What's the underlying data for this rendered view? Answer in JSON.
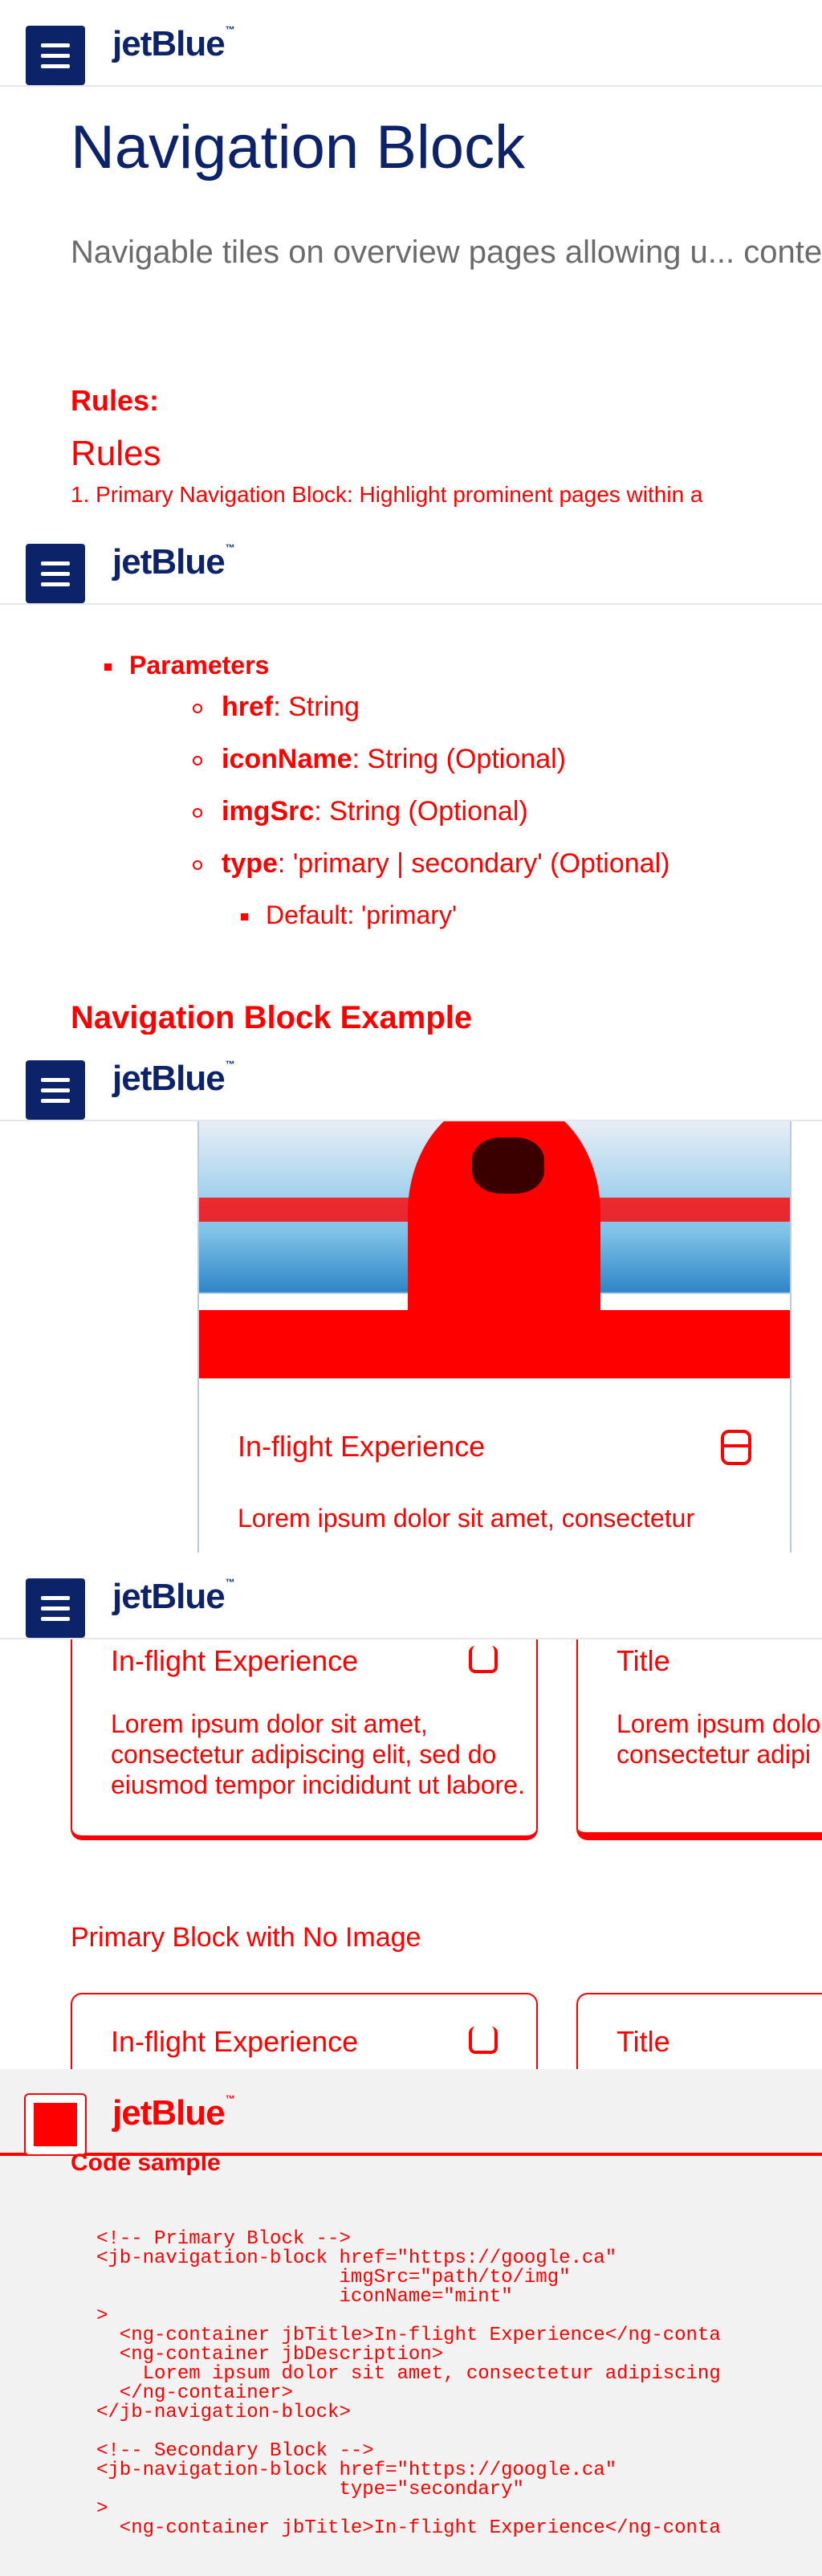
{
  "header": {
    "logo_text": "jetBlue",
    "logo_mark": "™",
    "menu_icon": "hamburger-icon"
  },
  "intro": {
    "title": "Navigation Block",
    "description": "Navigable tiles on overview pages allowing u... content.",
    "rules_label": "Rules:",
    "rules_heading": "Rules",
    "rule_1": "1. Primary Navigation Block: Highlight prominent pages within a"
  },
  "parameters": {
    "heading": "Parameters",
    "items": [
      {
        "name": "href",
        "type": ": String"
      },
      {
        "name": "iconName",
        "type": ": String (Optional)"
      },
      {
        "name": "imgSrc",
        "type": ": String (Optional)"
      },
      {
        "name": "type",
        "type": ": 'primary | secondary' (Optional)"
      }
    ],
    "default_note": "Default: 'primary'",
    "example_heading": "Navigation Block Example"
  },
  "example": {
    "tile_title": "In-flight Experience",
    "tile_desc": "Lorem ipsum dolor sit amet, consectetur",
    "icon": "database-icon"
  },
  "tiles": {
    "primary": {
      "title": "In-flight Experience",
      "desc": "Lorem ipsum dolor sit amet, consectetur adipiscing elit, sed do eiusmod tempor incididunt ut labore."
    },
    "secondary": {
      "title": "Title",
      "desc": "Lorem ipsum dolo consectetur adipi"
    },
    "no_image_heading": "Primary Block with No Image",
    "no_image_primary_title": "In-flight Experience",
    "no_image_secondary_title": "Title"
  },
  "code": {
    "heading": "Code sample",
    "sample": "<!-- Primary Block -->\n<jb-navigation-block href=\"https://google.ca\"\n                     imgSrc=\"path/to/img\"\n                     iconName=\"mint\"\n>\n  <ng-container jbTitle>In-flight Experience</ng-conta\n  <ng-container jbDescription>\n    Lorem ipsum dolor sit amet, consectetur adipiscing\n  </ng-container>\n</jb-navigation-block>\n\n<!-- Secondary Block -->\n<jb-navigation-block href=\"https://google.ca\"\n                     type=\"secondary\"\n>\n  <ng-container jbTitle>In-flight Experience</ng-conta"
  },
  "colors": {
    "brand_navy": "#0c2269",
    "accent_red": "#ff0000",
    "body_grey": "#6b6b6b"
  }
}
